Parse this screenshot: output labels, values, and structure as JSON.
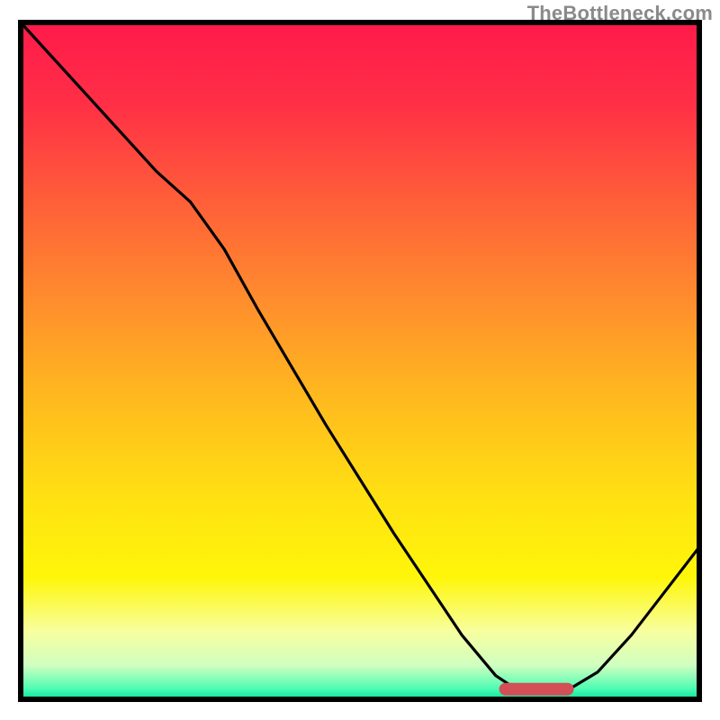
{
  "watermark": "TheBottleneck.com",
  "gradient": {
    "stops": [
      {
        "offset": 0.0,
        "color": "#ff1a4b"
      },
      {
        "offset": 0.12,
        "color": "#ff2f46"
      },
      {
        "offset": 0.25,
        "color": "#ff5a3a"
      },
      {
        "offset": 0.4,
        "color": "#ff8a2e"
      },
      {
        "offset": 0.55,
        "color": "#ffb81f"
      },
      {
        "offset": 0.7,
        "color": "#ffe012"
      },
      {
        "offset": 0.82,
        "color": "#fff60a"
      },
      {
        "offset": 0.9,
        "color": "#f7ffa0"
      },
      {
        "offset": 0.95,
        "color": "#d0ffc0"
      },
      {
        "offset": 0.985,
        "color": "#4bfcb3"
      },
      {
        "offset": 1.0,
        "color": "#00e59b"
      }
    ]
  },
  "frame": {
    "stroke": "#000000",
    "width": 6
  },
  "marker": {
    "color": "#d34e56",
    "x0": 0.705,
    "x1": 0.815,
    "y": 0.985,
    "thickness": 14,
    "radius": 7
  },
  "chart_data": {
    "type": "line",
    "title": "",
    "xlabel": "",
    "ylabel": "",
    "xlim": [
      0,
      1
    ],
    "ylim": [
      0,
      1
    ],
    "series": [
      {
        "name": "curve",
        "x": [
          0.0,
          0.05,
          0.1,
          0.15,
          0.2,
          0.25,
          0.3,
          0.35,
          0.4,
          0.45,
          0.5,
          0.55,
          0.6,
          0.65,
          0.7,
          0.73,
          0.76,
          0.8,
          0.85,
          0.9,
          0.95,
          1.0
        ],
        "y": [
          1.0,
          0.945,
          0.89,
          0.835,
          0.78,
          0.735,
          0.665,
          0.575,
          0.49,
          0.405,
          0.325,
          0.245,
          0.17,
          0.095,
          0.035,
          0.015,
          0.01,
          0.01,
          0.04,
          0.095,
          0.16,
          0.225
        ]
      }
    ],
    "annotations": []
  }
}
